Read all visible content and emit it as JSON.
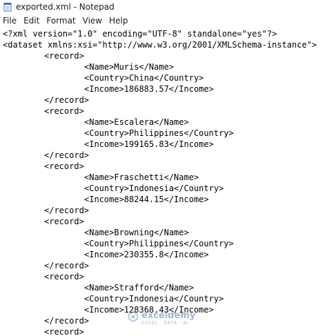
{
  "window": {
    "title": "exported.xml - Notepad"
  },
  "menubar": {
    "items": [
      "File",
      "Edit",
      "Format",
      "View",
      "Help"
    ]
  },
  "editor": {
    "lines": [
      "<?xml version=\"1.0\" encoding=\"UTF-8\" standalone=\"yes\"?>",
      "<dataset xmlns:xsi=\"http://www.w3.org/2001/XMLSchema-instance\">",
      "<record>",
      "<Name>Muris</Name>",
      "<Country>China</Country>",
      "<Income>186883.57</Income>",
      "</record>",
      "<record>",
      "<Name>Escalera</Name>",
      "<Country>Philippines</Country>",
      "<Income>199165.83</Income>",
      "</record>",
      "<record>",
      "<Name>Fraschetti</Name>",
      "<Country>Indonesia</Country>",
      "<Income>88244.15</Income>",
      "</record>",
      "<record>",
      "<Name>Browning</Name>",
      "<Country>Philippines</Country>",
      "<Income>230355.8</Income>",
      "</record>",
      "<record>",
      "<Name>Strafford</Name>",
      "<Country>Indonesia</Country>",
      "<Income>128368.43</Income>",
      "</record>",
      "<record>"
    ]
  },
  "watermark": {
    "name": "exceldemy",
    "tagline": "EXCEL · DATA · BI"
  }
}
